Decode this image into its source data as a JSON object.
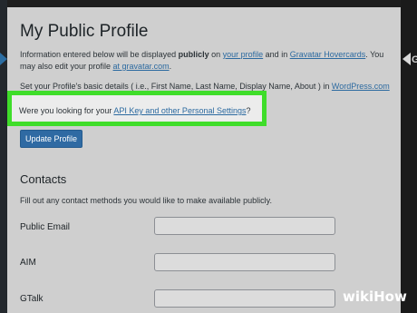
{
  "page": {
    "title": "My Public Profile",
    "intro": {
      "text1": "Information entered below will be displayed ",
      "bold": "publicly",
      "text2": " on ",
      "link_profile": "your profile",
      "text3": " and in ",
      "link_hovercards": "Gravatar Hovercards",
      "text4": ". You may also edit your profile ",
      "link_gravatar": "at gravatar.com",
      "text5": "."
    },
    "basic_details": {
      "text": "Set your Profile's basic details ( i.e., First Name, Last Name, Display Name, About ) in ",
      "link": "WordPress.com"
    },
    "highlight_prompt": {
      "text": "Were you looking for your ",
      "link": "API Key and other Personal Settings",
      "suffix": "?",
      "highlight_color": "#3fdd2a"
    },
    "update_button": "Update Profile",
    "contacts": {
      "title": "Contacts",
      "description": "Fill out any contact methods you would like to make available publicly.",
      "fields": [
        {
          "label": "Public Email",
          "value": ""
        },
        {
          "label": "AIM",
          "value": ""
        },
        {
          "label": "GTalk",
          "value": ""
        }
      ]
    }
  },
  "watermark": {
    "part1": "wiki",
    "part2": "How"
  },
  "side_glyph": "G",
  "colors": {
    "accent": "#2f6aa3",
    "link": "#2c6aa0",
    "panel": "#cfcfcf"
  }
}
